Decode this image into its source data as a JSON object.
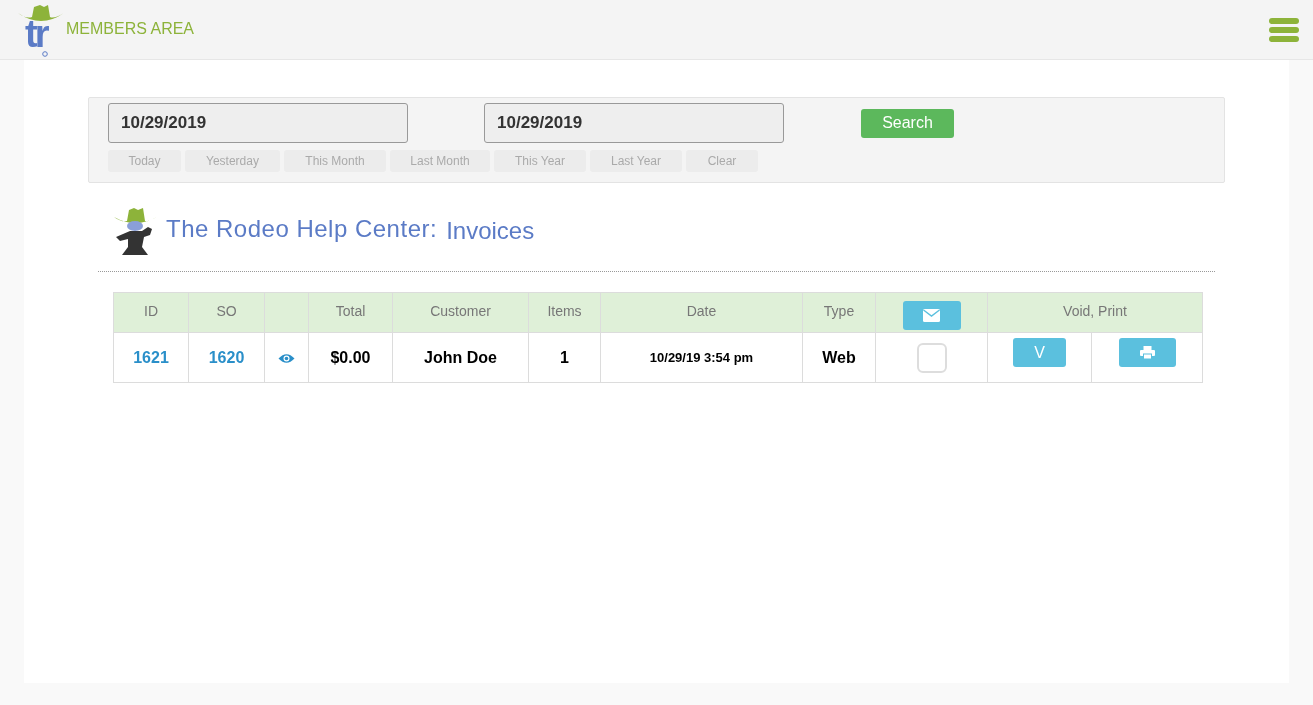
{
  "header": {
    "logo_text": "tr",
    "title": "MEMBERS AREA"
  },
  "filter": {
    "date_from": "10/29/2019",
    "date_to": "10/29/2019",
    "search_button": "Search",
    "quick_ranges": [
      "Today",
      "Yesterday",
      "This Month",
      "Last Month",
      "This Year",
      "Last Year",
      "Clear"
    ]
  },
  "page_title": {
    "title": "The Rodeo Help Center:",
    "subtitle": "Invoices"
  },
  "table": {
    "columns": [
      "ID",
      "SO",
      "",
      "Total",
      "Customer",
      "Items",
      "Date",
      "Type",
      "",
      "Void, Print"
    ],
    "rows": [
      {
        "id": "1621",
        "so": "1620",
        "total": "$0.00",
        "customer": "John Doe",
        "items": "1",
        "date": "10/29/19 3:54 pm",
        "type": "Web",
        "checked": false,
        "void_button": "V"
      }
    ]
  }
}
